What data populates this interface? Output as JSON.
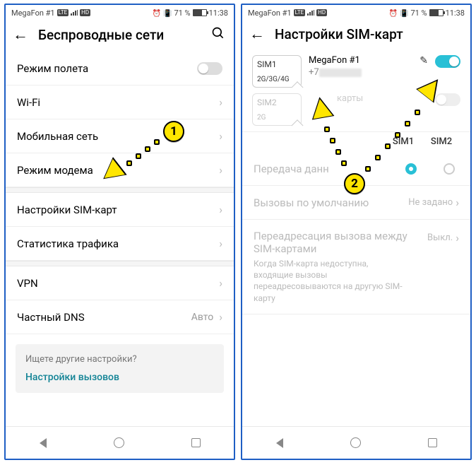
{
  "status": {
    "carrier": "MegaFon #1",
    "lte_badge": "LTE",
    "hd_badge": "HD",
    "battery_pct": "71 %",
    "time": "11:38"
  },
  "left": {
    "title": "Беспроводные сети",
    "rows": {
      "airplane": "Режим полета",
      "wifi": "Wi-Fi",
      "mobile": "Мобильная сеть",
      "tether": "Режим модема",
      "sim": "Настройки SIM-карт",
      "traffic": "Статистика трафика",
      "vpn": "VPN",
      "dns": "Частный DNS",
      "dns_value": "Авто"
    },
    "hint": {
      "q": "Ищете другие настройки?",
      "link": "Настройки вызовов"
    }
  },
  "right": {
    "title": "Настройки SIM-карт",
    "sim1": {
      "slot": "SIM1",
      "modes": "2G/3G/4G",
      "name": "MegaFon #1",
      "number_prefix": "+7"
    },
    "sim2": {
      "slot": "SIM2",
      "modes": "2G",
      "name_placeholder": "карты"
    },
    "cols": {
      "c1": "SIM1",
      "c2": "SIM2"
    },
    "data_row": "Передача данн",
    "default_calls": {
      "label": "Вызовы по умолчанию",
      "value": "Не задано"
    },
    "forward": {
      "title": "Переадресация вызова между SIM-картами",
      "sub": "Когда SIM-карта недоступна, входящие вызовы переадресовываются на другую SIM-карту",
      "value": "Выкл."
    }
  },
  "anno": {
    "one": "1",
    "two": "2"
  }
}
